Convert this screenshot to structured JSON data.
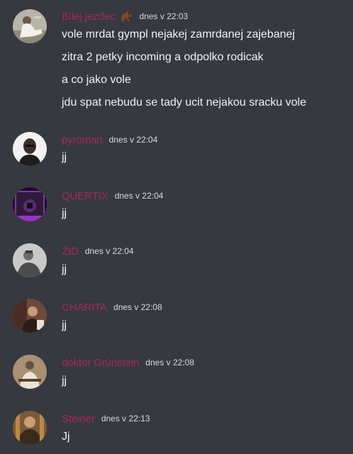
{
  "colors": {
    "background": "#36393f",
    "username": "#a4285c",
    "timestamp": "#d9dadb",
    "text": "#f1f1f2"
  },
  "messages": [
    {
      "author": "Bílej jezdec",
      "badge_icon": "horse-emoji-icon",
      "timestamp": "dnes v 22:03",
      "lines": [
        "vole mrdat gympl nejakej zamrdanej zajebanej",
        "zitra 2 petky incoming a odpolko rodicak",
        "a co jako vole",
        "jdu spat nebudu se tady ucit nejakou sracku vole"
      ]
    },
    {
      "author": "pyroman",
      "timestamp": "dnes v 22:04",
      "lines": [
        "jj"
      ]
    },
    {
      "author": "QUERTIX",
      "timestamp": "dnes v 22:04",
      "lines": [
        "jj"
      ]
    },
    {
      "author": "ŽID",
      "timestamp": "dnes v 22:04",
      "lines": [
        "jj"
      ]
    },
    {
      "author": "CHARITA",
      "timestamp": "dnes v 22:08",
      "lines": [
        "jj"
      ]
    },
    {
      "author": "doktor Grünstein",
      "timestamp": "dnes v 22:08",
      "lines": [
        "jj"
      ]
    },
    {
      "author": "Steiner",
      "timestamp": "dnes v 22:13",
      "lines": [
        "Jj"
      ]
    }
  ]
}
